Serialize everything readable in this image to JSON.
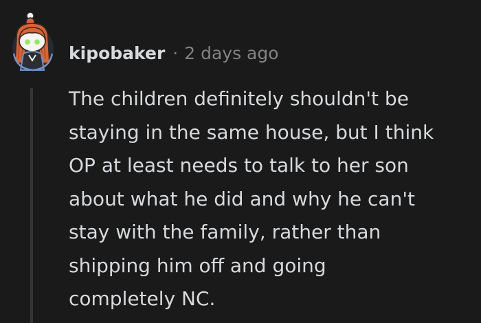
{
  "comment": {
    "username": "kipobaker",
    "separator": "·",
    "timestamp": "2 days ago",
    "body_lines": [
      "The children definitely shouldn't be",
      "staying in the same house, but I think",
      "OP at least needs to talk to her son",
      "about what he did and why he can't",
      "stay with the family, rather than",
      "shipping him off and going",
      "completely NC."
    ]
  },
  "avatar": {
    "icon": "reddit-snoo-avatar-icon",
    "colors": {
      "hair": "#e0622c",
      "skin": "#f5f5f5",
      "eyes": "#8cf04a",
      "body": "#2b2f33",
      "outline": "#6e94c8"
    }
  },
  "theme": {
    "background": "#1a1a1b",
    "text": "#d7dadc",
    "muted": "#818384",
    "thread_line": "#343536"
  }
}
